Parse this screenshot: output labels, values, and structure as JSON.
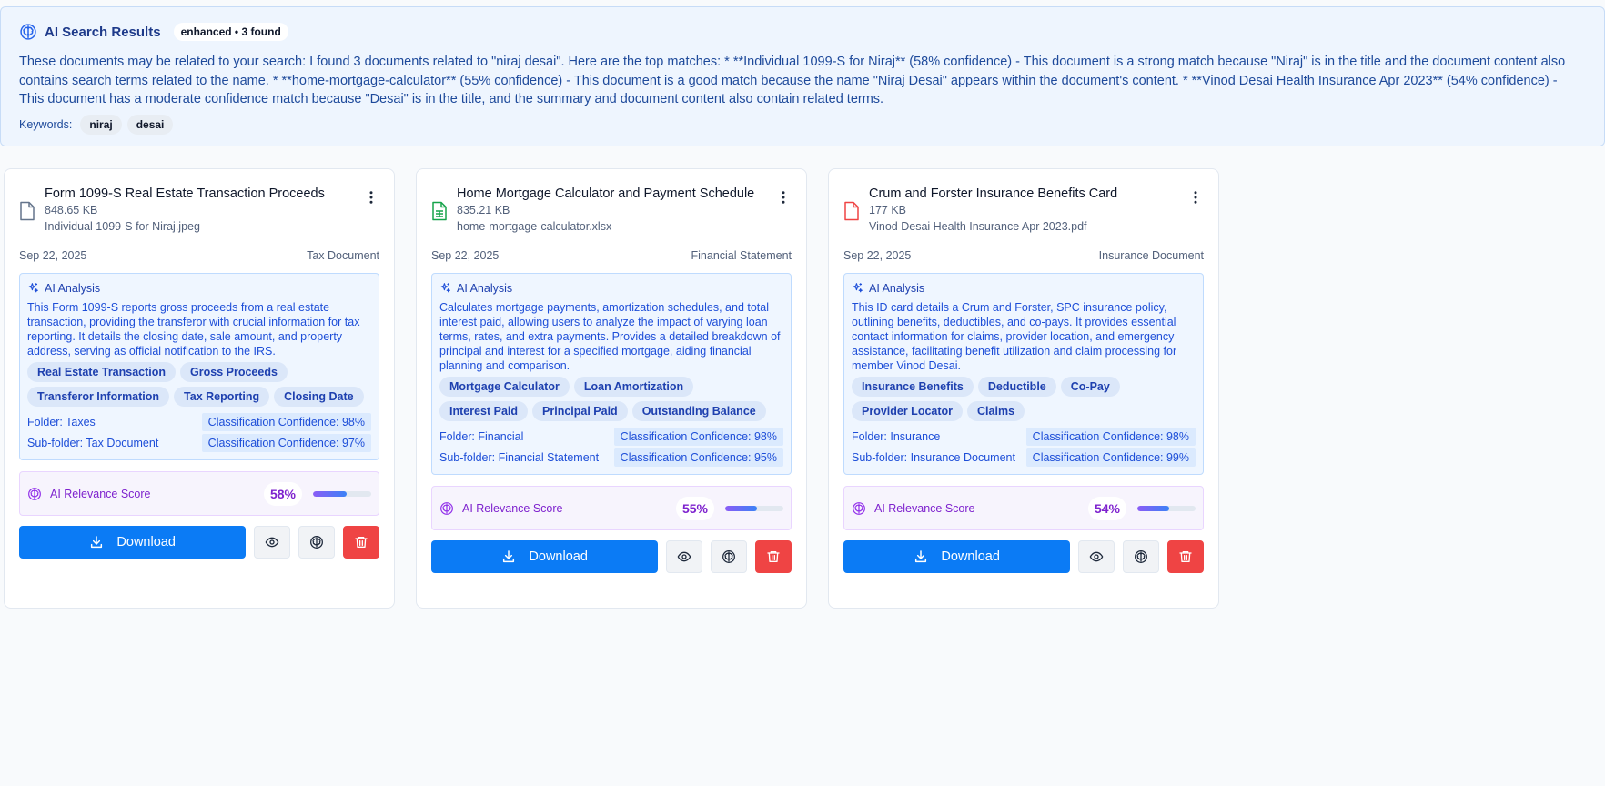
{
  "banner": {
    "title": "AI Search Results",
    "badge": "enhanced • 3 found",
    "text": "These documents may be related to your search: I found 3 documents related to \"niraj desai\". Here are the top matches: * **Individual 1099-S for Niraj** (58% confidence) - This document is a strong match because \"Niraj\" is in the title and the document content also contains search terms related to the name. * **home-mortgage-calculator** (55% confidence) - This document is a good match because the name \"Niraj Desai\" appears within the document's content. * **Vinod Desai Health Insurance Apr 2023** (54% confidence) - This document has a moderate confidence match because \"Desai\" is in the title, and the summary and document content also contain related terms.",
    "keywords_label": "Keywords:",
    "keywords": [
      "niraj",
      "desai"
    ]
  },
  "labels": {
    "ai_analysis": "AI Analysis",
    "relevance": "AI Relevance Score",
    "download": "Download"
  },
  "cards": [
    {
      "title": "Form 1099-S Real Estate Transaction Proceeds",
      "size": "848.65 KB",
      "filename": "Individual 1099-S for Niraj.jpeg",
      "date": "Sep 22, 2025",
      "category": "Tax Document",
      "icon": "file-icon",
      "icon_color": "#64748b",
      "analysis": "This Form 1099-S reports gross proceeds from a real estate transaction, providing the transferor with crucial information for tax reporting. It details the closing date, sale amount, and property address, serving as official notification to the IRS.",
      "tags": [
        "Real Estate Transaction",
        "Gross Proceeds",
        "Transferor Information",
        "Tax Reporting",
        "Closing Date"
      ],
      "folder": "Folder: Taxes",
      "folder_conf": "Classification Confidence: 98%",
      "subfolder": "Sub-folder: Tax Document",
      "subfolder_conf": "Classification Confidence: 97%",
      "score": "58%",
      "score_value": 0.58
    },
    {
      "title": "Home Mortgage Calculator and Payment Schedule",
      "size": "835.21 KB",
      "filename": "home-mortgage-calculator.xlsx",
      "date": "Sep 22, 2025",
      "category": "Financial Statement",
      "icon": "spreadsheet-icon",
      "icon_color": "#16a34a",
      "analysis": "Calculates mortgage payments, amortization schedules, and total interest paid, allowing users to analyze the impact of varying loan terms, rates, and extra payments. Provides a detailed breakdown of principal and interest for a specified mortgage, aiding financial planning and comparison.",
      "tags": [
        "Mortgage Calculator",
        "Loan Amortization",
        "Interest Paid",
        "Principal Paid",
        "Outstanding Balance"
      ],
      "folder": "Folder: Financial",
      "folder_conf": "Classification Confidence: 98%",
      "subfolder": "Sub-folder: Financial Statement",
      "subfolder_conf": "Classification Confidence: 95%",
      "score": "55%",
      "score_value": 0.55
    },
    {
      "title": "Crum and Forster Insurance Benefits Card",
      "size": "177 KB",
      "filename": "Vinod Desai Health Insurance Apr 2023.pdf",
      "date": "Sep 22, 2025",
      "category": "Insurance Document",
      "icon": "pdf-file-icon",
      "icon_color": "#ef4444",
      "analysis": "This ID card details a Crum and Forster, SPC insurance policy, outlining benefits, deductibles, and co-pays. It provides essential contact information for claims, provider location, and emergency assistance, facilitating benefit utilization and claim processing for member Vinod Desai.",
      "tags": [
        "Insurance Benefits",
        "Deductible",
        "Co-Pay",
        "Provider Locator",
        "Claims"
      ],
      "folder": "Folder: Insurance",
      "folder_conf": "Classification Confidence: 98%",
      "subfolder": "Sub-folder: Insurance Document",
      "subfolder_conf": "Classification Confidence: 99%",
      "score": "54%",
      "score_value": 0.54
    }
  ]
}
